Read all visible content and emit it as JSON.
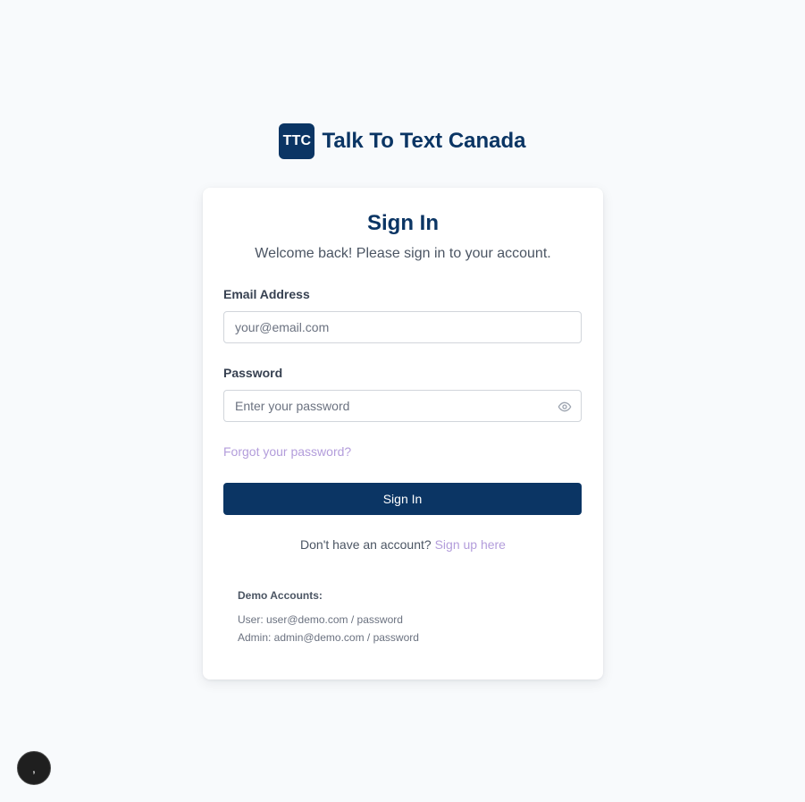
{
  "brand": {
    "logo_text": "TTC",
    "name": "Talk To Text Canada",
    "logo_color": "#0b3564"
  },
  "signin": {
    "title": "Sign In",
    "subtitle": "Welcome back! Please sign in to your account.",
    "email_label": "Email Address",
    "email_placeholder": "your@email.com",
    "email_value": "",
    "password_label": "Password",
    "password_placeholder": "Enter your password",
    "password_value": "",
    "password_toggle_icon": "eye-icon",
    "forgot_link": "Forgot your password?",
    "submit_label": "Sign In",
    "no_account_text": "Don't have an account?",
    "signup_link": "Sign up here"
  },
  "demo": {
    "title": "Demo Accounts:",
    "user_line": "User: user@demo.com / password",
    "admin_line": "Admin: admin@demo.com / password"
  },
  "fab": {
    "glyph": ",",
    "icon": "floating-action-icon"
  },
  "colors": {
    "primary": "#0b3564",
    "link": "#b39ddb",
    "background": "#f8fafc"
  }
}
